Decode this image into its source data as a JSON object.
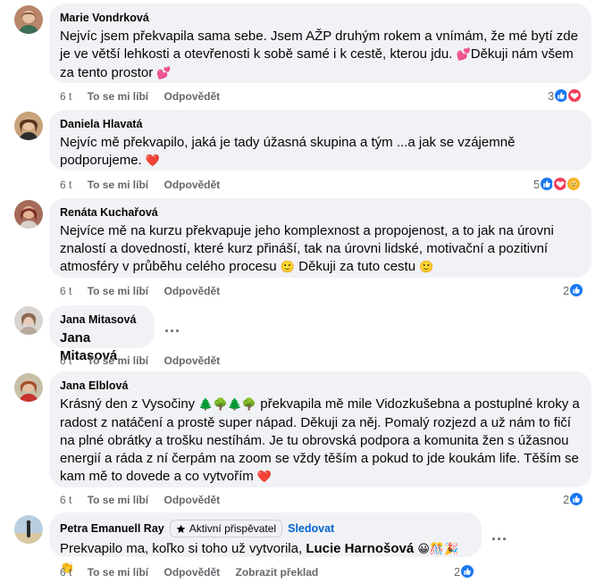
{
  "comments": [
    {
      "author": "Marie Vondrková",
      "text": "Nejvíc jsem překvapila sama sebe. Jsem AŽP druhým rokem a vnímám, že mé bytí zde je ve větší lehkosti a otevřenosti k sobě samé i k cestě, kterou jdu. ",
      "text_emoji_1": "💕",
      "text_2": "Děkuji nám všem za tento prostor ",
      "text_emoji_2": "💕",
      "time": "6 t",
      "like": "To se mi líbí",
      "reply": "Odpovědět",
      "reaction_count": "3"
    },
    {
      "author": "Daniela Hlavatá",
      "text": "Nejvíc mě překvapilo, jaká je tady úžasná skupina a tým ...a jak se vzájemně podporujeme. ",
      "text_emoji_1": "❤️",
      "time": "6 t",
      "like": "To se mi líbí",
      "reply": "Odpovědět",
      "reaction_count": "5"
    },
    {
      "author": "Renáta Kuchařová",
      "text": "Nejvíce mě na kurzu překvapuje jeho komplexnost a propojenost, a to jak na úrovni znalostí a dovedností, které kurz přináší, tak na úrovni lidské, motivační a pozitivní atmosféry v průběhu celého procesu ",
      "text_emoji_1": "🙂",
      "text_2": " Děkuji za tuto cestu ",
      "text_emoji_2": "🙂",
      "time": "6 t",
      "like": "To se mi líbí",
      "reply": "Odpovědět",
      "reaction_count": "2"
    },
    {
      "author": "Jana Mitasová",
      "text": "Jana Mitasová",
      "time": "6 t",
      "like": "To se mi líbí",
      "reply": "Odpovědět"
    },
    {
      "author": "Jana Elblová",
      "text": "Krásný den z Vysočiny ",
      "text_emoji_1": "🌲🌳🌲🌳",
      "text_2": " překvapila mě mile Vidozkušebna a postuplné kroky a radost z natáčení a prostě super nápad. Děkuji za něj. Pomalý rozjezd a už nám to fičí na plné obrátky a trošku nestíhám. Je tu obrovská podpora a komunita žen s úžasnou energií a ráda z ní čerpám na zoom se vždy těším a pokud to jde koukám life. Těším se kam mě to dovede a co vytvořím ",
      "text_emoji_2": "❤️",
      "time": "6 t",
      "like": "To se mi líbí",
      "reply": "Odpovědět",
      "reaction_count": "2"
    },
    {
      "author": "Petra Emanuell Ray",
      "badge": "Aktivní přispěvatel",
      "follow": "Sledovat",
      "text": "Prekvapilo ma, koľko si toho už vytvorila, ",
      "mention": "Lucie Harnošová",
      "text_emoji_1": "😀🎊🎉👏",
      "time": "6 t",
      "like": "To se mi líbí",
      "reply": "Odpovědět",
      "translate": "Zobrazit překlad",
      "reaction_count": "2"
    }
  ],
  "more_options": "...",
  "colors": {
    "bubble": "#f0f2f5",
    "meta": "#65676b",
    "like": "#1877f2",
    "love": "#f33e58",
    "link": "#0064d1"
  }
}
